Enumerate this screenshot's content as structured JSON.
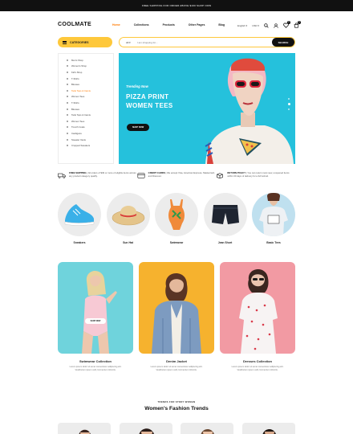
{
  "topbar": {
    "text": "FREE SHIPPING FOR ORDER ABOVE $160 SHOP NOW"
  },
  "header": {
    "logo": "COOLMATE",
    "nav": [
      {
        "label": "Home",
        "active": true
      },
      {
        "label": "Collections",
        "active": false
      },
      {
        "label": "Products",
        "active": false
      },
      {
        "label": "Other Pages",
        "active": false
      },
      {
        "label": "Blog",
        "active": false
      }
    ],
    "language": "English",
    "currency": "USD",
    "wishlist_count": "0",
    "cart_count": "0"
  },
  "categories_button": {
    "label": "CATEGORIES"
  },
  "search": {
    "category": "All",
    "placeholder": "I am shopping for...",
    "button_label": "SEARCH"
  },
  "sidebar": {
    "items": [
      "Men's Shop",
      "Women's Shop",
      "Kid's Shop",
      "T-Shirts",
      "Blouses",
      "Tank Tops & Camis",
      "Women Tees",
      "T-Shirts",
      "Blouses",
      "Tank Tops & Camis",
      "Women Tees",
      "Trench Coats",
      "Cardigans",
      "Sweater Vests",
      "Cropped Sweaters"
    ],
    "active_index": 5
  },
  "hero": {
    "tagline": "Trending Now",
    "title_line1": "PIZZA PRINT",
    "title_line2": "WOMEN TEES",
    "button_label": "SHOP NOW",
    "background": "#25c1dc"
  },
  "features": [
    {
      "title": "FREE SHIPPING",
      "text": "All orders of $49 or more of eligible items across any product category qualify."
    },
    {
      "title": "CREDIT CARDS",
      "text": "We accept Visa, American Express, Mastercard, and Discover."
    },
    {
      "title": "RETURN POLICY",
      "text": "You can return most new, unopened items within 30 days of delivery for a full refund."
    }
  ],
  "products": [
    {
      "label": "Sneakers"
    },
    {
      "label": "Sun Hat"
    },
    {
      "label": "Swimwear"
    },
    {
      "label": "Jean Short"
    },
    {
      "label": "Basic Tees"
    }
  ],
  "collections": [
    {
      "title": "Swimwear Collection",
      "desc_line1": "Lorem ipsum dolor sit amet consectetur adipiscing elit.",
      "desc_line2": "Vestibulum ipsum velit, fermentum lobortis.",
      "bg": "#6fd3dc",
      "button_label": "SHOP NOW"
    },
    {
      "title": "Denim Jacket",
      "desc_line1": "Lorem ipsum dolor sit amet consectetur adipiscing elit.",
      "desc_line2": "Vestibulum ipsum velit, fermentum lobortis.",
      "bg": "#f6b22e"
    },
    {
      "title": "Dresses Collection",
      "desc_line1": "Lorem ipsum dolor sit amet consectetur adipiscing elit.",
      "desc_line2": "Vestibulum ipsum velit, fermentum lobortis.",
      "bg": "#f29aa3"
    }
  ],
  "trends": {
    "eyebrow": "TRENDS FOR STORY WOMAN",
    "title": "Women's Fashion Trends"
  },
  "colors": {
    "accent": "#fec83b",
    "active_link": "#ff7a00",
    "dark": "#111111"
  }
}
